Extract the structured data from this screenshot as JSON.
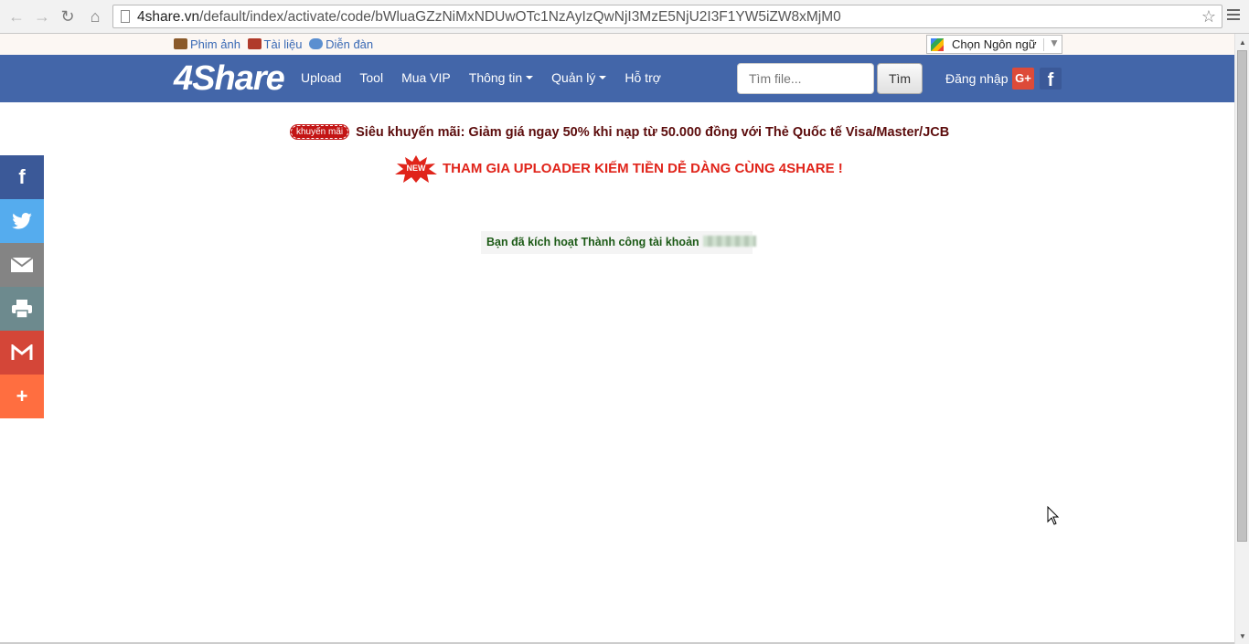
{
  "browser": {
    "url_host": "4share.vn",
    "url_path": "/default/index/activate/code/bWluaGZzNiMxNDUwOTc1NzAyIzQwNjI3MzE5NjU2I3F1YW5iZW8xMjM0"
  },
  "subbar": {
    "links": [
      "Phim ảnh",
      "Tài liệu",
      "Diễn đàn"
    ],
    "language_label": "Chọn Ngôn ngữ"
  },
  "navbar": {
    "logo": "4Share",
    "menu": [
      {
        "label": "Upload"
      },
      {
        "label": "Tool"
      },
      {
        "label": "Mua VIP"
      },
      {
        "label": "Thông tin"
      },
      {
        "label": "Quản lý"
      },
      {
        "label": "Hỗ trợ"
      }
    ],
    "search_placeholder": "Tìm file...",
    "search_button": "Tìm",
    "login": "Đăng nhập",
    "gplus_label": "G+",
    "fb_label": "f"
  },
  "promo": {
    "badge": "khuyến mãi",
    "text": "Siêu khuyến mãi: Giảm giá ngay 50% khi nạp từ 50.000 đồng với Thẻ Quốc tế Visa/Master/JCB",
    "new_badge": "NEW",
    "uploader_text": "THAM GIA UPLOADER KIẾM TIỀN DỄ DÀNG CÙNG 4SHARE !"
  },
  "message": {
    "success": "Bạn đã kích hoạt Thành công tài khoản"
  },
  "colors": {
    "navbar": "#4366a9",
    "promo_dark_red": "#5c0c0c",
    "promo_red": "#e0241a",
    "success_green": "#1c5a16"
  }
}
